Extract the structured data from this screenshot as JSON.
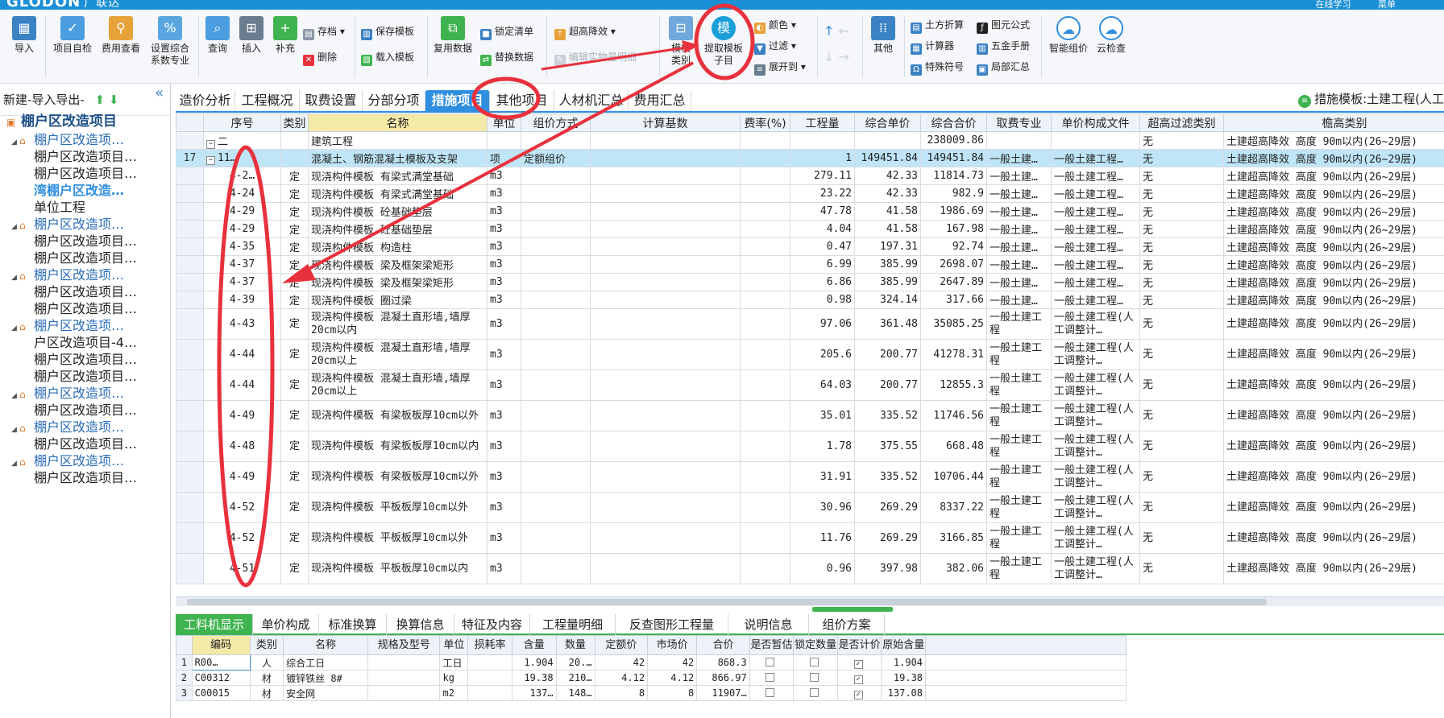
{
  "titlebar": {
    "brand": "GLODON",
    "brand_sub": "广联达",
    "online_learning": "在线学习",
    "menu_label": "菜单"
  },
  "toolbar": {
    "import": "导入",
    "project_self_check": "项目自检",
    "fee_view": "费用查看",
    "set_comprehensive_l1": "设置综合",
    "set_comprehensive_l2": "系数专业",
    "query": "查询",
    "insert": "插入",
    "supplement": "补充",
    "archive": "存档",
    "delete": "删除",
    "save_template": "保存模板",
    "load_template": "载入模板",
    "reuse_data": "复用数据",
    "lock_list": "锁定清单",
    "replace_data": "替换数据",
    "overheight_reduction": "超高降效",
    "edit_quantity_formula": "编辑实物量明细",
    "tpl_category_l1": "模板",
    "tpl_category_l2": "类别",
    "extract_tpl_l1": "提取模板",
    "extract_tpl_l2": "子目",
    "extract_tpl_icon": "模",
    "color": "颜色",
    "filter": "过滤",
    "expand_to": "展开到",
    "other": "其他",
    "earth_convert": "土方折算",
    "calculator": "计算器",
    "special_symbol": "特殊符号",
    "element_formula": "图元公式",
    "hardware_manual": "五金手册",
    "local_summary": "局部汇总",
    "smart_pricing": "智能组价",
    "cloud_check": "云检查"
  },
  "left_panel": {
    "header": "新建-导入导出-",
    "items": [
      {
        "label": "棚户区改造项目",
        "level": 0
      },
      {
        "label": "棚户区改造项…",
        "level": 1
      },
      {
        "label": "棚户区改造项目…",
        "level": 2
      },
      {
        "label": "棚户区改造项目…",
        "level": 2
      },
      {
        "label": "湾棚户区改造…",
        "level": 2,
        "selected": true
      },
      {
        "label": "单位工程",
        "level": 2
      },
      {
        "label": "棚户区改造项…",
        "level": 1
      },
      {
        "label": "棚户区改造项目…",
        "level": 2
      },
      {
        "label": "棚户区改造项目…",
        "level": 2
      },
      {
        "label": "棚户区改造项…",
        "level": 1
      },
      {
        "label": "棚户区改造项目…",
        "level": 2
      },
      {
        "label": "棚户区改造项目…",
        "level": 2
      },
      {
        "label": "棚户区改造项…",
        "level": 1
      },
      {
        "label": "户区改造项目-4…",
        "level": 2
      },
      {
        "label": "棚户区改造项目…",
        "level": 2
      },
      {
        "label": "棚户区改造项目…",
        "level": 2
      },
      {
        "label": "棚户区改造项…",
        "level": 1
      },
      {
        "label": "棚户区改造项目…",
        "level": 2
      },
      {
        "label": "棚户区改造项…",
        "level": 1
      },
      {
        "label": "棚户区改造项目…",
        "level": 2
      },
      {
        "label": "棚户区改造项…",
        "level": 1
      },
      {
        "label": "棚户区改造项目…",
        "level": 2
      }
    ]
  },
  "tabs": [
    "造价分析",
    "工程概况",
    "取费设置",
    "分部分项",
    "措施项目",
    "其他项目",
    "人材机汇总",
    "费用汇总"
  ],
  "active_tab": "措施项目",
  "template_label": "措施模板:土建工程(人工",
  "grid": {
    "columns": [
      "序号",
      "类别",
      "名称",
      "单位",
      "组价方式",
      "计算基数",
      "费率(%)",
      "工程量",
      "综合单价",
      "综合合价",
      "取费专业",
      "单价构成文件",
      "超高过滤类别",
      "檐高类别"
    ],
    "rows": [
      {
        "rn": "",
        "code": "二",
        "cat": "",
        "name": "建筑工程",
        "unit": "",
        "method": "",
        "base": "",
        "rate": "",
        "qty": "",
        "price": "",
        "total": "238009.86",
        "fee": "",
        "file": "",
        "filter": "无",
        "eave": "土建超高降效 高度 90m以内(26~29层)"
      },
      {
        "rn": "17",
        "code": "11…",
        "cat": "",
        "name": "混凝土、钢筋混凝土模板及支架",
        "unit": "项",
        "method": "定额组价",
        "base": "",
        "rate": "",
        "qty": "1",
        "price": "149451.84",
        "total": "149451.84",
        "fee": "一般土建…",
        "file": "一般土建工程…",
        "filter": "无",
        "eave": "土建超高降效 高度 90m以内(26~29层)"
      },
      {
        "rn": "",
        "code": "4-2…",
        "cat": "定",
        "name": "现浇构件模板 有梁式满堂基础",
        "unit": "m3",
        "method": "",
        "base": "",
        "rate": "",
        "qty": "279.11",
        "price": "42.33",
        "total": "11814.73",
        "fee": "一般土建…",
        "file": "一般土建工程…",
        "filter": "无",
        "eave": "土建超高降效 高度 90m以内(26~29层)"
      },
      {
        "rn": "",
        "code": "4-24",
        "cat": "定",
        "name": "现浇构件模板 有梁式满堂基础",
        "unit": "m3",
        "method": "",
        "base": "",
        "rate": "",
        "qty": "23.22",
        "price": "42.33",
        "total": "982.9",
        "fee": "一般土建…",
        "file": "一般土建工程…",
        "filter": "无",
        "eave": "土建超高降效 高度 90m以内(26~29层)"
      },
      {
        "rn": "",
        "code": "4-29",
        "cat": "定",
        "name": "现浇构件模板 砼基础垫层",
        "unit": "m3",
        "method": "",
        "base": "",
        "rate": "",
        "qty": "47.78",
        "price": "41.58",
        "total": "1986.69",
        "fee": "一般土建…",
        "file": "一般土建工程…",
        "filter": "无",
        "eave": "土建超高降效 高度 90m以内(26~29层)"
      },
      {
        "rn": "",
        "code": "4-29",
        "cat": "定",
        "name": "现浇构件模板 砼基础垫层",
        "unit": "m3",
        "method": "",
        "base": "",
        "rate": "",
        "qty": "4.04",
        "price": "41.58",
        "total": "167.98",
        "fee": "一般土建…",
        "file": "一般土建工程…",
        "filter": "无",
        "eave": "土建超高降效 高度 90m以内(26~29层)"
      },
      {
        "rn": "",
        "code": "4-35",
        "cat": "定",
        "name": "现浇构件模板 构造柱",
        "unit": "m3",
        "method": "",
        "base": "",
        "rate": "",
        "qty": "0.47",
        "price": "197.31",
        "total": "92.74",
        "fee": "一般土建…",
        "file": "一般土建工程…",
        "filter": "无",
        "eave": "土建超高降效 高度 90m以内(26~29层)"
      },
      {
        "rn": "",
        "code": "4-37",
        "cat": "定",
        "name": "现浇构件模板 梁及框架梁矩形",
        "unit": "m3",
        "method": "",
        "base": "",
        "rate": "",
        "qty": "6.99",
        "price": "385.99",
        "total": "2698.07",
        "fee": "一般土建…",
        "file": "一般土建工程…",
        "filter": "无",
        "eave": "土建超高降效 高度 90m以内(26~29层)"
      },
      {
        "rn": "",
        "code": "4-37",
        "cat": "定",
        "name": "现浇构件模板 梁及框架梁矩形",
        "unit": "m3",
        "method": "",
        "base": "",
        "rate": "",
        "qty": "6.86",
        "price": "385.99",
        "total": "2647.89",
        "fee": "一般土建…",
        "file": "一般土建工程…",
        "filter": "无",
        "eave": "土建超高降效 高度 90m以内(26~29层)"
      },
      {
        "rn": "",
        "code": "4-39",
        "cat": "定",
        "name": "现浇构件模板 圈过梁",
        "unit": "m3",
        "method": "",
        "base": "",
        "rate": "",
        "qty": "0.98",
        "price": "324.14",
        "total": "317.66",
        "fee": "一般土建…",
        "file": "一般土建工程…",
        "filter": "无",
        "eave": "土建超高降效 高度 90m以内(26~29层)"
      },
      {
        "rn": "",
        "code": "4-43",
        "cat": "定",
        "name": "现浇构件模板 混凝土直形墙,墙厚20cm以内",
        "unit": "m3",
        "method": "",
        "base": "",
        "rate": "",
        "qty": "97.06",
        "price": "361.48",
        "total": "35085.25",
        "fee": "一般土建工程",
        "file": "一般土建工程(人工调整计…",
        "filter": "无",
        "eave": "土建超高降效 高度 90m以内(26~29层)",
        "tall": true
      },
      {
        "rn": "",
        "code": "4-44",
        "cat": "定",
        "name": "现浇构件模板 混凝土直形墙,墙厚20cm以上",
        "unit": "m3",
        "method": "",
        "base": "",
        "rate": "",
        "qty": "205.6",
        "price": "200.77",
        "total": "41278.31",
        "fee": "一般土建工程",
        "file": "一般土建工程(人工调整计…",
        "filter": "无",
        "eave": "土建超高降效 高度 90m以内(26~29层)",
        "tall": true
      },
      {
        "rn": "",
        "code": "4-44",
        "cat": "定",
        "name": "现浇构件模板 混凝土直形墙,墙厚20cm以上",
        "unit": "m3",
        "method": "",
        "base": "",
        "rate": "",
        "qty": "64.03",
        "price": "200.77",
        "total": "12855.3",
        "fee": "一般土建工程",
        "file": "一般土建工程(人工调整计…",
        "filter": "无",
        "eave": "土建超高降效 高度 90m以内(26~29层)",
        "tall": true
      },
      {
        "rn": "",
        "code": "4-49",
        "cat": "定",
        "name": "现浇构件模板 有梁板板厚10cm以外",
        "unit": "m3",
        "method": "",
        "base": "",
        "rate": "",
        "qty": "35.01",
        "price": "335.52",
        "total": "11746.56",
        "fee": "一般土建工程",
        "file": "一般土建工程(人工调整计…",
        "filter": "无",
        "eave": "土建超高降效 高度 90m以内(26~29层)",
        "tall": true
      },
      {
        "rn": "",
        "code": "4-48",
        "cat": "定",
        "name": "现浇构件模板 有梁板板厚10cm以内",
        "unit": "m3",
        "method": "",
        "base": "",
        "rate": "",
        "qty": "1.78",
        "price": "375.55",
        "total": "668.48",
        "fee": "一般土建工程",
        "file": "一般土建工程(人工调整计…",
        "filter": "无",
        "eave": "土建超高降效 高度 90m以内(26~29层)",
        "tall": true
      },
      {
        "rn": "",
        "code": "4-49",
        "cat": "定",
        "name": "现浇构件模板 有梁板板厚10cm以外",
        "unit": "m3",
        "method": "",
        "base": "",
        "rate": "",
        "qty": "31.91",
        "price": "335.52",
        "total": "10706.44",
        "fee": "一般土建工程",
        "file": "一般土建工程(人工调整计…",
        "filter": "无",
        "eave": "土建超高降效 高度 90m以内(26~29层)",
        "tall": true
      },
      {
        "rn": "",
        "code": "4-52",
        "cat": "定",
        "name": "现浇构件模板 平板板厚10cm以外",
        "unit": "m3",
        "method": "",
        "base": "",
        "rate": "",
        "qty": "30.96",
        "price": "269.29",
        "total": "8337.22",
        "fee": "一般土建工程",
        "file": "一般土建工程(人工调整计…",
        "filter": "无",
        "eave": "土建超高降效 高度 90m以内(26~29层)",
        "tall": true
      },
      {
        "rn": "",
        "code": "4-52",
        "cat": "定",
        "name": "现浇构件模板 平板板厚10cm以外",
        "unit": "m3",
        "method": "",
        "base": "",
        "rate": "",
        "qty": "11.76",
        "price": "269.29",
        "total": "3166.85",
        "fee": "一般土建工程",
        "file": "一般土建工程(人工调整计…",
        "filter": "无",
        "eave": "土建超高降效 高度 90m以内(26~29层)",
        "tall": true
      },
      {
        "rn": "",
        "code": "4-51",
        "cat": "定",
        "name": "现浇构件模板 平板板厚10cm以内",
        "unit": "m3",
        "method": "",
        "base": "",
        "rate": "",
        "qty": "0.96",
        "price": "397.98",
        "total": "382.06",
        "fee": "一般土建工程",
        "file": "一般土建工程(人工调整计…",
        "filter": "无",
        "eave": "土建超高降效 高度 90m以内(26~29层)",
        "tall": true
      }
    ]
  },
  "bottom_tabs": [
    "工料机显示",
    "单价构成",
    "标准换算",
    "换算信息",
    "特征及内容",
    "工程量明细",
    "反查图形工程量",
    "说明信息",
    "组价方案"
  ],
  "active_bottom_tab": "工料机显示",
  "detail": {
    "columns": [
      "编码",
      "类别",
      "名称",
      "规格及型号",
      "单位",
      "损耗率",
      "含量",
      "数量",
      "定额价",
      "市场价",
      "合价",
      "是否暂估",
      "锁定数量",
      "是否计价",
      "原始含量"
    ],
    "rows": [
      {
        "rn": "1",
        "code": "R00…",
        "cat": "人",
        "name": "综合工日",
        "spec": "",
        "unit": "工日",
        "loss": "",
        "content": "1.904",
        "qty": "20.…",
        "quota": "42",
        "market": "42",
        "total": "868.3",
        "est": false,
        "lock": false,
        "priced": true,
        "orig": "1.904"
      },
      {
        "rn": "2",
        "code": "C00312",
        "cat": "材",
        "name": "镀锌铁丝 8#",
        "spec": "",
        "unit": "kg",
        "loss": "",
        "content": "19.38",
        "qty": "210…",
        "quota": "4.12",
        "market": "4.12",
        "total": "866.97",
        "est": false,
        "lock": false,
        "priced": true,
        "orig": "19.38"
      },
      {
        "rn": "3",
        "code": "C00015",
        "cat": "材",
        "name": "安全网",
        "spec": "",
        "unit": "m2",
        "loss": "",
        "content": "137…",
        "qty": "148…",
        "quota": "8",
        "market": "8",
        "total": "11907…",
        "est": false,
        "lock": false,
        "priced": true,
        "orig": "137.08"
      }
    ]
  },
  "colors": {
    "accent": "#2f8ee0",
    "green": "#3fb34f",
    "annotation": "#e8313c"
  }
}
